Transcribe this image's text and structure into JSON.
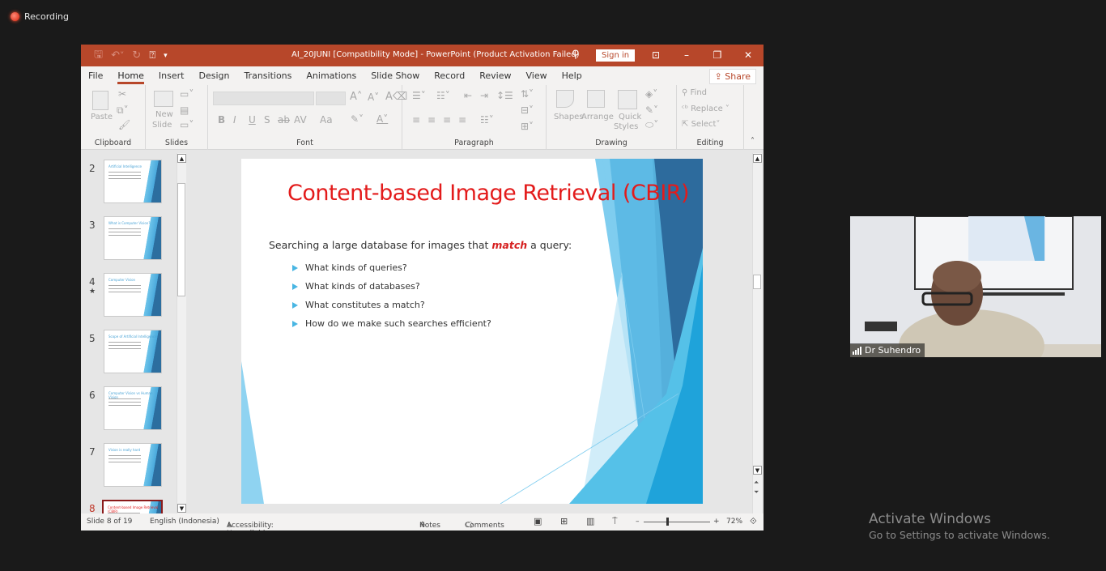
{
  "meeting": {
    "recording_label": "Recording",
    "participant_name": "Dr Suhendro"
  },
  "window": {
    "title": "AI_20JUNI [Compatibility Mode]  -  PowerPoint (Product Activation Failed)",
    "sign_in_label": "Sign in",
    "share_label": "Share"
  },
  "tabs": [
    "File",
    "Home",
    "Insert",
    "Design",
    "Transitions",
    "Animations",
    "Slide Show",
    "Record",
    "Review",
    "View",
    "Help"
  ],
  "active_tab": "Home",
  "ribbon": {
    "groups": [
      "Clipboard",
      "Slides",
      "Font",
      "Paragraph",
      "Drawing",
      "Editing"
    ],
    "paste_label": "Paste",
    "new_slide_label_1": "New",
    "new_slide_label_2": "Slide",
    "font_buttons": [
      "B",
      "I",
      "U",
      "S",
      "ab",
      "AV",
      "Aa"
    ],
    "shapes_label": "Shapes",
    "arrange_label": "Arrange",
    "quick_styles_label_1": "Quick",
    "quick_styles_label_2": "Styles",
    "find_label": "Find",
    "replace_label": "Replace",
    "select_label": "Select"
  },
  "thumbnails": [
    {
      "number": "2",
      "title": "Artificial Intelligence"
    },
    {
      "number": "3",
      "title": "What is Computer Vision?"
    },
    {
      "number": "4",
      "title": "Computer Vision",
      "has_animation": true
    },
    {
      "number": "5",
      "title": "Scope of Artificial Intelligence"
    },
    {
      "number": "6",
      "title": "Computer Vision vs Human Vision"
    },
    {
      "number": "7",
      "title": "Vision is really hard"
    },
    {
      "number": "8",
      "title": "Content-based Image Retrieval (CBIR)",
      "selected": true
    }
  ],
  "slide": {
    "title": "Content-based Image Retrieval (CBIR)",
    "lead_before": "Searching a large database for images that ",
    "lead_emphasis": "match",
    "lead_after": " a query:",
    "bullets": [
      "What kinds of queries?",
      "What kinds of databases?",
      "What constitutes a match?",
      "How do we make such searches efficient?"
    ]
  },
  "status": {
    "slide_counter": "Slide 8 of 19",
    "language": "English (Indonesia)",
    "accessibility": "Accessibility: Unavailable",
    "notes_label": "Notes",
    "comments_label": "Comments",
    "zoom_level": "72%"
  },
  "watermark": {
    "line1": "Activate Windows",
    "line2": "Go to Settings to activate Windows."
  },
  "colors": {
    "ppt_accent": "#b7472a",
    "slide_title": "#e31b1b",
    "bullet": "#49b6e3"
  }
}
